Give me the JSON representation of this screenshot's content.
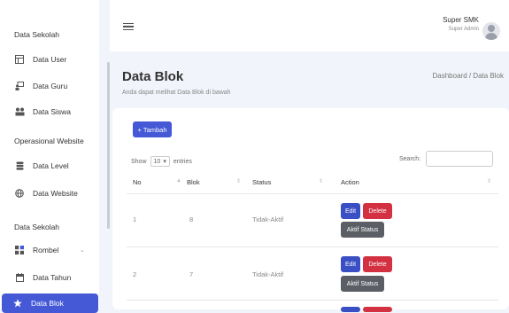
{
  "sidebar": {
    "heading1": "Data Sekolah",
    "heading2": "Operasional Website",
    "heading3": "Data Sekolah",
    "items": [
      {
        "label": "Data User",
        "icon": "table-icon"
      },
      {
        "label": "Data Guru",
        "icon": "person-board-icon"
      },
      {
        "label": "Data Siswa",
        "icon": "students-icon"
      },
      {
        "label": "Data Level",
        "icon": "database-icon"
      },
      {
        "label": "Data Website",
        "icon": "globe-icon"
      },
      {
        "label": "Rombel",
        "icon": "grid-icon"
      },
      {
        "label": "Data Tahun",
        "icon": "calendar-icon"
      },
      {
        "label": "Data Blok",
        "icon": "star-icon"
      }
    ]
  },
  "topbar": {
    "menu_icon": "hamburger-icon",
    "user_name": "Super SMK",
    "user_role": "Super Admin"
  },
  "page": {
    "title": "Data Blok",
    "subtitle": "Anda dapat melihat Data Blok di bawah",
    "breadcrumb": "Dashboard / Data Blok"
  },
  "toolbar": {
    "add_label": "+ Tambah",
    "show_label": "Show",
    "entries_value": "10",
    "entries_label": "entries",
    "search_label": "Search:",
    "search_value": ""
  },
  "table": {
    "headers": [
      "No",
      "Blok",
      "Status",
      "Action"
    ],
    "rows": [
      {
        "no": "1",
        "blok": "8",
        "status": "Tidak-Aktif"
      },
      {
        "no": "2",
        "blok": "7",
        "status": "Tidak-Aktif"
      }
    ],
    "edit_label": "Edit",
    "delete_label": "Delete",
    "status_label": "Aktif Status"
  },
  "colors": {
    "accent": "#4559d6",
    "danger": "#d33142",
    "secondary": "#5b5f65",
    "background": "#f1f4fa"
  }
}
